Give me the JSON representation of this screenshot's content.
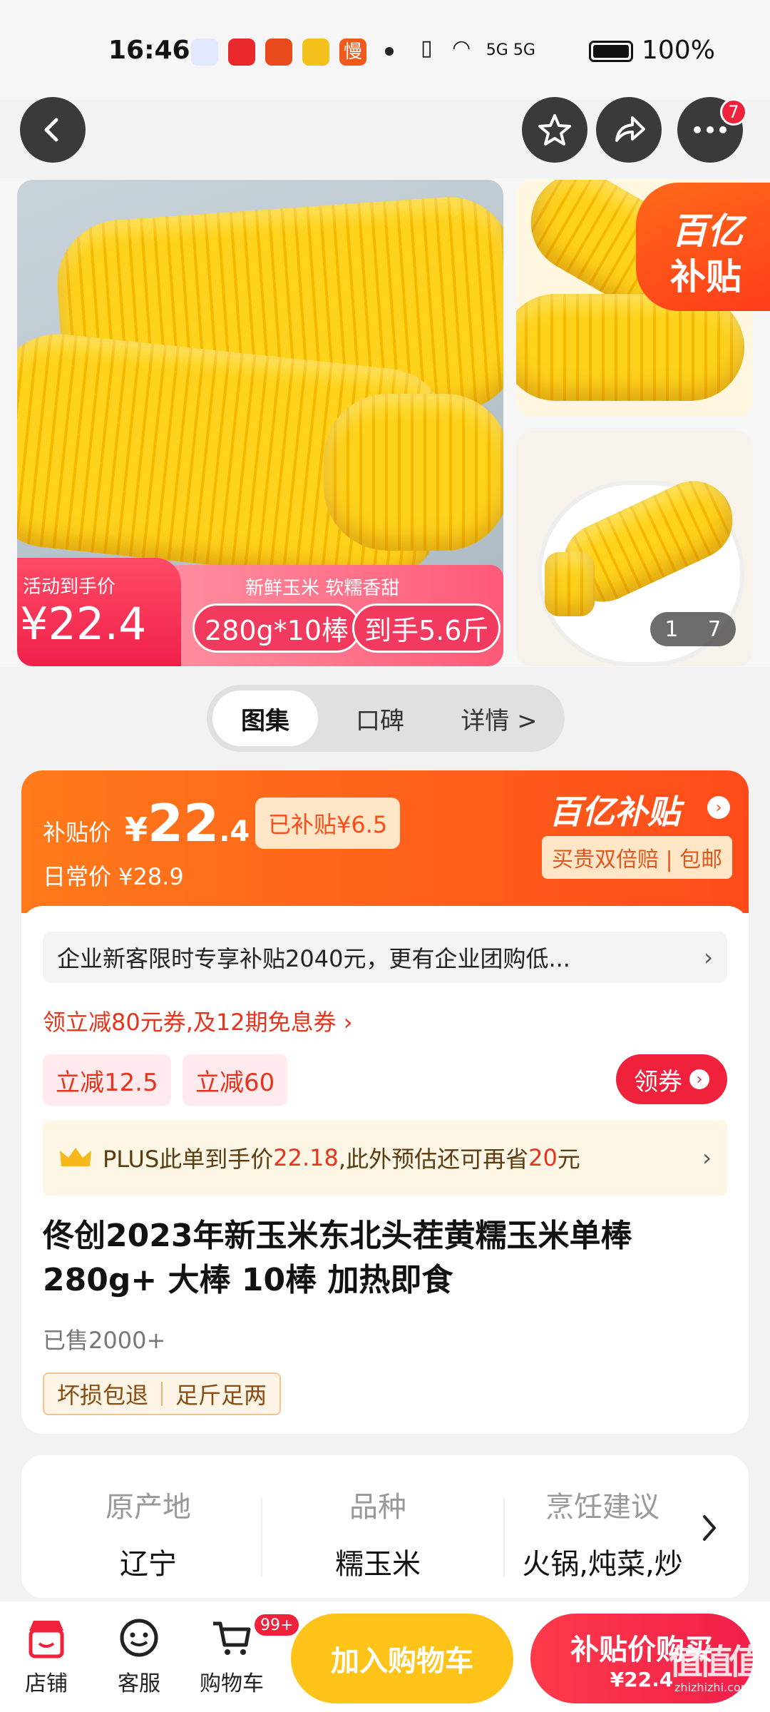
{
  "status_bar": {
    "time": "16:46",
    "battery": "100%",
    "network": "5G 5G"
  },
  "gallery": {
    "promo_label": "活动到手价",
    "promo_price": "¥22.4",
    "promo_slogan": "新鲜玉米 软糯香甜",
    "promo_spec": "280g*10棒",
    "promo_weight": "到手5.6斤",
    "yi_tag": [
      "百亿",
      "补贴"
    ],
    "page_current": "1",
    "page_total": "7"
  },
  "menu_badge": "7",
  "tabs": [
    {
      "label": "图集"
    },
    {
      "label": "口碑"
    },
    {
      "label": "详情 >"
    }
  ],
  "price": {
    "subsidy_label": "补贴价",
    "currency": "¥",
    "price_int": "22",
    "price_dec": ".4",
    "subsidized": "已补贴¥6.5",
    "daily": "日常价 ¥28.9",
    "brand": "百亿补贴",
    "guarantee": "买贵双倍赔 | 包邮"
  },
  "notice": {
    "text": "企业新客限时专享补贴2040元，更有企业团购低...",
    "chevron": "›"
  },
  "coupon_link": "领立减80元券,及12期免息券 ›",
  "chips": [
    "立减12.5",
    "立减60"
  ],
  "get_coupon": "领券",
  "plus": {
    "pre": "PLUS此单到手价",
    "price": "22.18",
    "mid": ",此外预估还可再省",
    "save": "20",
    "post": "元",
    "chevron": "›"
  },
  "product": {
    "title": "佟创2023年新玉米东北头茬黄糯玉米单棒280g+ 大棒 10棒 加热即食",
    "sold": "已售2000+",
    "tags": [
      "坏损包退",
      "足斤足两"
    ]
  },
  "attributes": [
    {
      "key": "原产地",
      "value": "辽宁"
    },
    {
      "key": "品种",
      "value": "糯玉米"
    },
    {
      "key": "烹饪建议",
      "value": "火锅,炖菜,炒"
    }
  ],
  "bottom_nav": [
    {
      "label": "店铺",
      "icon": "store-icon"
    },
    {
      "label": "客服",
      "icon": "chat-icon"
    },
    {
      "label": "购物车",
      "icon": "cart-icon",
      "badge": "99+"
    }
  ],
  "buttons": {
    "add_cart": "加入购物车",
    "buy_line1": "补贴价购买",
    "buy_line2": "¥22.4"
  },
  "watermark": {
    "logo": "值值值",
    "site": "zhizhizhi.com"
  }
}
